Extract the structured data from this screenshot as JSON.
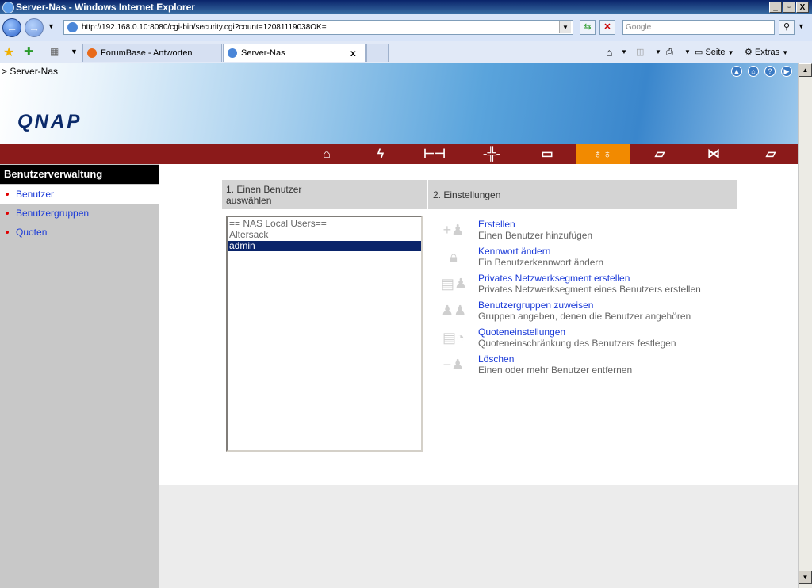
{
  "window": {
    "title": "Server-Nas - Windows Internet Explorer",
    "controls": [
      "_",
      "▫",
      "X"
    ]
  },
  "addressbar": {
    "url": "http://192.168.0.10:8080/cgi-bin/security.cgi?count=12081119038OK=",
    "search_placeholder": "Google"
  },
  "tabs": [
    {
      "label": "ForumBase - Antworten"
    },
    {
      "label": "Server-Nas",
      "close": "x"
    }
  ],
  "commandbar": {
    "page": "Seite",
    "extras": "Extras"
  },
  "banner": {
    "breadcrumb": "> Server-Nas",
    "logo": "QNAP"
  },
  "menu": {
    "icons": [
      "home-icon",
      "network-icon",
      "system-tools-icon",
      "device-icon",
      "disk-icon",
      "user-management-icon",
      "share-folder-icon",
      "network-services-icon",
      "status-icon"
    ],
    "active_index": 5
  },
  "sidebar": {
    "title": "Benutzerverwaltung",
    "items": [
      {
        "label": "Benutzer"
      },
      {
        "label": "Benutzergruppen"
      },
      {
        "label": "Quoten"
      }
    ],
    "selected_index": 0
  },
  "step1": {
    "line1": "1. Einen Benutzer",
    "line2": "auswählen"
  },
  "step2": {
    "label": "2. Einstellungen"
  },
  "userlist": {
    "options": [
      "== NAS Local Users==",
      "Altersack",
      "admin"
    ],
    "selected": "admin"
  },
  "actions": [
    {
      "link": "Erstellen",
      "desc": "Einen Benutzer hinzufügen",
      "icon": "add-user-icon"
    },
    {
      "link": "Kennwort ändern",
      "desc": "Ein Benutzerkennwort ändern",
      "icon": "lock-icon"
    },
    {
      "link": "Privates Netzwerksegment erstellen",
      "desc": "Privates Netzwerksegment eines Benutzers erstellen",
      "icon": "network-share-icon"
    },
    {
      "link": "Benutzergruppen zuweisen",
      "desc": "Gruppen angeben, denen die Benutzer angehören",
      "icon": "group-icon"
    },
    {
      "link": "Quoteneinstellungen",
      "desc": "Quoteneinschränkung des Benutzers festlegen",
      "icon": "quota-icon"
    },
    {
      "link": "Löschen",
      "desc": "Einen oder mehr Benutzer entfernen",
      "icon": "delete-user-icon"
    }
  ],
  "colors": {
    "menu_bg": "#8b1a1a",
    "menu_active": "#f28a00",
    "link": "#1a3ad8",
    "sidebar_bg": "#c8c8c8"
  }
}
